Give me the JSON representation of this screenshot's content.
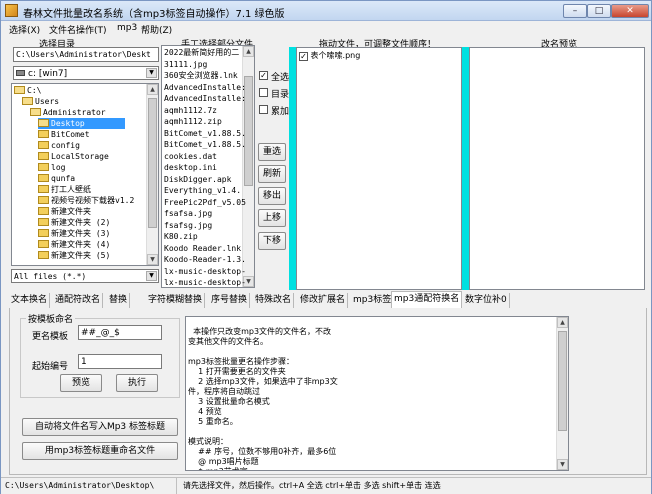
{
  "window": {
    "title": "春林文件批量改名系统（含mp3标签自动操作）7.1  绿色版",
    "min_label": "–",
    "max_label": "□",
    "close_label": "✕"
  },
  "menu": [
    "选择(X)",
    "文件名操作(T)",
    "mp3",
    "帮助(Z)"
  ],
  "left": {
    "header": "选择目录",
    "path": "C:\\Users\\Administrator\\Deskt",
    "drive": "c: [win7]",
    "tree": [
      {
        "label": "C:\\",
        "level": 0,
        "open": true,
        "selected": false
      },
      {
        "label": "Users",
        "level": 1,
        "open": true,
        "selected": false
      },
      {
        "label": "Administrator",
        "level": 2,
        "open": true,
        "selected": false
      },
      {
        "label": "Desktop",
        "level": 3,
        "open": true,
        "selected": true
      },
      {
        "label": "BitComet",
        "level": 3,
        "open": false,
        "selected": false
      },
      {
        "label": "config",
        "level": 3,
        "open": false,
        "selected": false
      },
      {
        "label": "LocalStorage",
        "level": 3,
        "open": false,
        "selected": false
      },
      {
        "label": "log",
        "level": 3,
        "open": false,
        "selected": false
      },
      {
        "label": "qunfa",
        "level": 3,
        "open": false,
        "selected": false
      },
      {
        "label": "打工人壁纸",
        "level": 3,
        "open": false,
        "selected": false
      },
      {
        "label": "视频号视频下载器v1.2",
        "level": 3,
        "open": false,
        "selected": false
      },
      {
        "label": "新建文件夹",
        "level": 3,
        "open": false,
        "selected": false
      },
      {
        "label": "新建文件夹 (2)",
        "level": 3,
        "open": false,
        "selected": false
      },
      {
        "label": "新建文件夹 (3)",
        "level": 3,
        "open": false,
        "selected": false
      },
      {
        "label": "新建文件夹 (4)",
        "level": 3,
        "open": false,
        "selected": false
      },
      {
        "label": "新建文件夹 (5)",
        "level": 3,
        "open": false,
        "selected": false
      }
    ],
    "filter": "All files (*.*)"
  },
  "files": {
    "header": "手工选择部分文件",
    "items": [
      "2022最新简好用的二",
      "31111.jpg",
      "360安全浏览器.lnk",
      "AdvancedInstalle:",
      "AdvancedInstalle:",
      "aqmh1112.7z",
      "aqmh1112.zip",
      "BitComet_v1.88.5.",
      "BitComet_v1.88.5.",
      "cookies.dat",
      "desktop.ini",
      "DiskDigger.apk",
      "Everything_v1.4.",
      "FreePic2Pdf_v5.05",
      "fsafsa.jpg",
      "fsafsg.jpg",
      "K80.zip",
      "Koodo Reader.lnk",
      "Koodo-Reader-1.3.",
      "lx-music-desktop-",
      "lx-music-desktop-"
    ]
  },
  "controls": {
    "check_all": "全选",
    "check_dir": "目录",
    "check_accum": "累加",
    "check_all_value": true,
    "reselect": "重选",
    "refresh": "刷新",
    "move_out": "移出",
    "move_up": "上移",
    "move_down": "下移"
  },
  "drag": {
    "header": "拖动文件，可调整文件顺序！",
    "items": [
      "表个嗦嗦.png"
    ]
  },
  "preview": {
    "header": "改名预览"
  },
  "tabs": [
    "文本换名",
    "通配符改名",
    "替换",
    "字符模糊替换",
    "序号替换",
    "特殊改名",
    "修改扩展名",
    "mp3标签",
    "mp3通配符换名",
    "数字位补0"
  ],
  "active_tab": 8,
  "panel": {
    "group_title": "按模板命名",
    "template_label": "更名模板",
    "template_value": "##_@_$",
    "start_label": "起始编号",
    "start_value": "1",
    "preview_btn": "预览",
    "exec_btn": "执行",
    "auto_btn": "自动将文件名写入Mp3 标签标题",
    "rename_btn": "用mp3标签标题重命名文件"
  },
  "help_text": [
    "  本操作只改变mp3文件的文件名，不改",
    "变其他文件的文件名。",
    "",
    "mp3标签批量更名操作步骤：",
    "    1 打开需要更名的文件夹",
    "    2 选择mp3文件，如果选中了非mp3文",
    "件，程序将自动跳过",
    "    3 设置批量命名模式",
    "    4 预览",
    "    5 重命名。",
    "",
    "模式说明：",
    "    ## 序号，位数不够用0补齐，最多6位",
    "    @ mp3唱片标题",
    "    $ mp3艺术家"
  ],
  "status": {
    "path": "C:\\Users\\Administrator\\Desktop\\",
    "hint": "请先选择文件，然后操作。ctrl+A 全选 ctrl+单击 多选 shift+单击 连选"
  },
  "colors": {
    "accent_cyan": "#00e0e0",
    "selection": "#3399ff"
  }
}
